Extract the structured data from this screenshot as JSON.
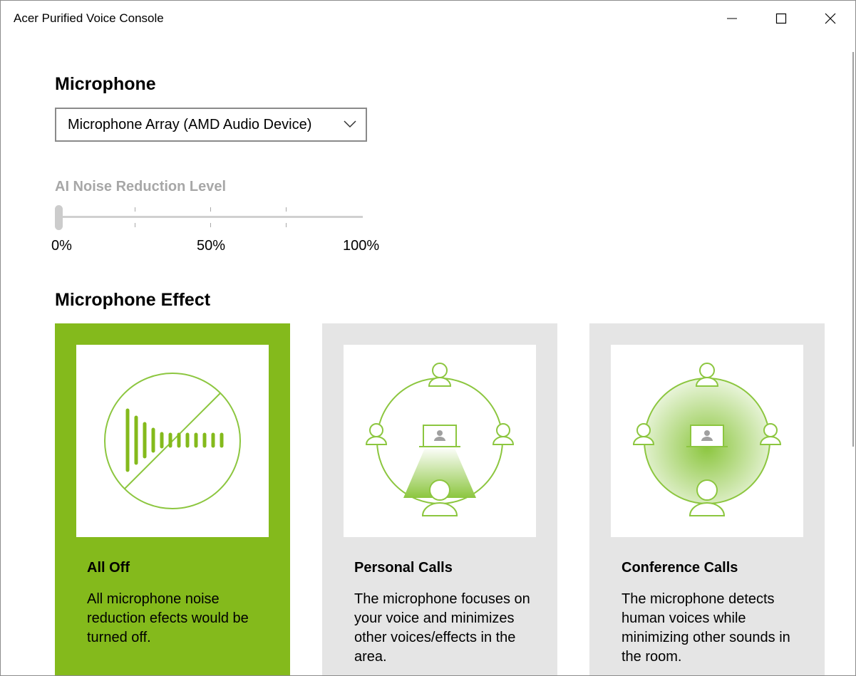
{
  "window": {
    "title": "Acer Purified Voice Console"
  },
  "microphone": {
    "heading": "Microphone",
    "device_selected": "Microphone Array (AMD Audio Device)"
  },
  "noise_reduction": {
    "label": "AI Noise Reduction Level",
    "value_fraction": 0,
    "tick_labels": [
      "0%",
      "50%",
      "100%"
    ]
  },
  "effect": {
    "heading": "Microphone Effect",
    "cards": [
      {
        "title": "All Off",
        "description": "All microphone noise reduction efects would be turned off.",
        "selected": true
      },
      {
        "title": "Personal Calls",
        "description": "The microphone focuses on your voice and minimizes other voices/effects in the area.",
        "selected": false
      },
      {
        "title": "Conference Calls",
        "description": "The microphone detects human voices while minimizing other sounds in the room.",
        "selected": false
      }
    ]
  },
  "colors": {
    "accent": "#84ba1c",
    "icon_green": "#8cc63f",
    "card_bg": "#e5e5e5",
    "disabled_text": "#a7a7a7"
  },
  "icons": [
    "minimize-icon",
    "maximize-icon",
    "close-icon",
    "chevron-down-icon",
    "mute-waveform-icon",
    "personal-call-icon",
    "conference-call-icon"
  ]
}
